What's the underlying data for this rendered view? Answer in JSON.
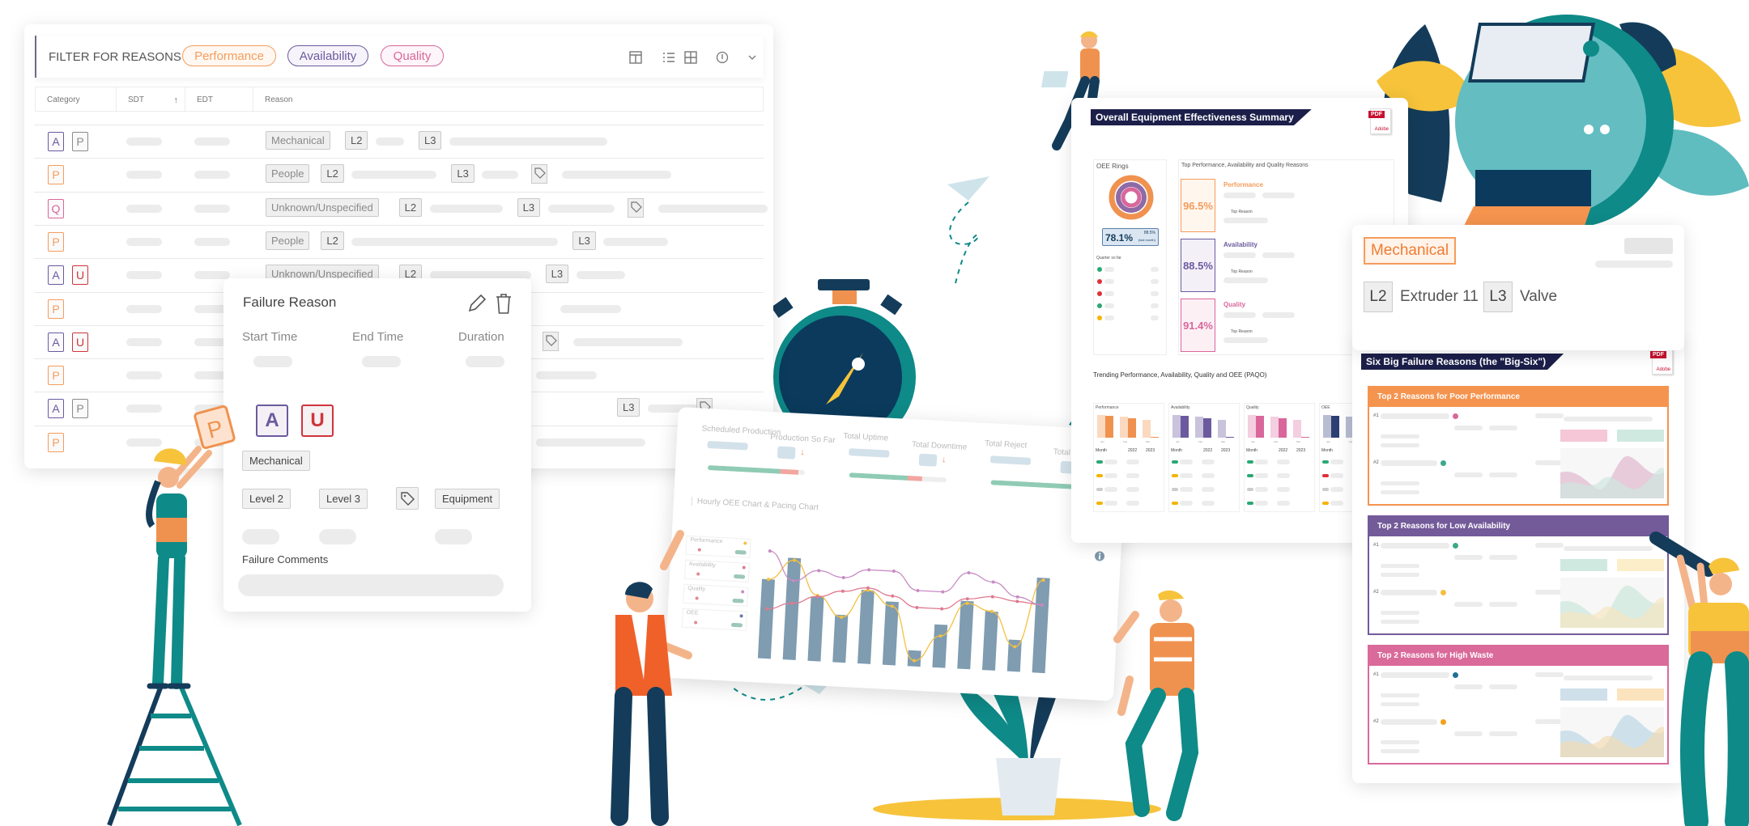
{
  "filter_panel": {
    "title": "FILTER FOR REASONS",
    "filters": [
      {
        "label": "Performance",
        "color": "#f59c5b"
      },
      {
        "label": "Availability",
        "color": "#6b5a9e"
      },
      {
        "label": "Quality",
        "color": "#d9679b"
      }
    ],
    "toolbar_icons": [
      "layout-icon",
      "list-icon",
      "grid-icon",
      "info-icon",
      "chevron-down-icon"
    ],
    "columns": [
      "Category",
      "SDT",
      "EDT",
      "Reason"
    ],
    "sort_icon": "arrow-up-icon",
    "rows": [
      {
        "categories": [
          "A",
          "P"
        ],
        "reason": "Mechanical",
        "l2": "L2",
        "l3": "L3",
        "tag": false
      },
      {
        "categories": [
          "P"
        ],
        "reason": "People",
        "l2": "L2",
        "l3": "L3",
        "tag": true
      },
      {
        "categories": [
          "Q"
        ],
        "reason": "Unknown/Unspecified",
        "l2": "L2",
        "l3": "L3",
        "tag": true
      },
      {
        "categories": [
          "P"
        ],
        "reason": "People",
        "l2": "L2",
        "l3": "L3",
        "tag": false
      },
      {
        "categories": [
          "A",
          "U"
        ],
        "reason": "Unknown/Unspecified",
        "l2": "L2",
        "l3": "L3",
        "tag": false
      },
      {
        "categories": [
          "P"
        ]
      },
      {
        "categories": [
          "A",
          "U"
        ],
        "tag": true
      },
      {
        "categories": [
          "P"
        ]
      },
      {
        "categories": [
          "A",
          "P"
        ],
        "l3": "L3",
        "tag": true
      },
      {
        "categories": [
          "P"
        ]
      }
    ],
    "category_colors": {
      "A": "#6b5a9e",
      "P": "#f59c5b",
      "Q": "#d9679b",
      "U": "#d0343d",
      "P-secondary": "#8a8a8a"
    }
  },
  "failure_reason": {
    "title": "Failure Reason",
    "edit_icon": "pencil-icon",
    "delete_icon": "trash-icon",
    "time_labels": [
      "Start Time",
      "End Time",
      "Duration"
    ],
    "categories": [
      "A",
      "U"
    ],
    "reason": "Mechanical",
    "levels": [
      "Level 2",
      "Level 3"
    ],
    "equipment": "Equipment",
    "comments_label": "Failure Comments",
    "held_card": "P"
  },
  "oee_summary": {
    "title": "Overall Equipment Effectiveness Summary",
    "pdf_label": "PDF",
    "pdf_brand": "Adobe",
    "rings_title": "OEE Rings",
    "oee_value": "78.1%",
    "oee_last": "88.5%",
    "oee_last_label": "(last month)",
    "quarter_label": "Quarter so far",
    "quarter_dots": [
      "#2aa876",
      "#e0303a",
      "#e0303a",
      "#2aa876",
      "#f4b400"
    ],
    "reasons_title": "Top Performance, Availability and Quality Reasons",
    "metrics": [
      {
        "name": "Performance",
        "value": "96.5%",
        "color": "#f59c5b",
        "bg": "#fff6ee",
        "sub": "Top Reason"
      },
      {
        "name": "Availability",
        "value": "88.5%",
        "color": "#6b5a9e",
        "bg": "#f3f0f8",
        "sub": "Top Reason"
      },
      {
        "name": "Quality",
        "value": "91.4%",
        "color": "#d9679b",
        "bg": "#fcf0f5",
        "sub": "Top Reason"
      }
    ],
    "trending_title": "Trending Performance, Availability, Quality and OEE (PAQO)",
    "trend_panels": [
      {
        "name": "Performance",
        "c1": "#fbd9bf",
        "c2": "#f0924f"
      },
      {
        "name": "Availability",
        "c1": "#c9c3dc",
        "c2": "#6b5a9e"
      },
      {
        "name": "Quality",
        "c1": "#f3cfe0",
        "c2": "#d9679b"
      },
      {
        "name": "OEE",
        "c1": "#b9bdd2",
        "c2": "#2b3f73"
      }
    ],
    "trend_months": [
      "Jan",
      "Feb",
      "Mar"
    ],
    "trend_legend": [
      "Month",
      "2022",
      "2023"
    ]
  },
  "mechanical_card": {
    "reason": "Mechanical",
    "l2_label": "L2",
    "l2_value": "Extruder 11",
    "l3_label": "L3",
    "l3_value": "Valve"
  },
  "big_six": {
    "title": "Six Big Failure Reasons (the \"Big-Six\")",
    "pdf_label": "PDF",
    "pdf_brand": "Adobe",
    "sections": [
      {
        "title": "Top 2 Reasons for Poor Performance",
        "color": "#f5944f",
        "dots": [
          "#d9679b",
          "#3aa98a"
        ],
        "chips": [
          "#f6c7d6",
          "#cfe9e1"
        ],
        "areas": [
          "#e4bfd3",
          "#cfe6e0"
        ]
      },
      {
        "title": "Top 2 Reasons for Low Availability",
        "color": "#735a99",
        "dots": [
          "#3aa98a",
          "#f4c042"
        ],
        "chips": [
          "#cfe9e1",
          "#fbeec8"
        ],
        "areas": [
          "#cfe8df",
          "#f7e6c0"
        ]
      },
      {
        "title": "Top 2 Reasons for High Waste",
        "color": "#d96a9a",
        "dots": [
          "#1f6f96",
          "#f3a11c"
        ],
        "chips": [
          "#cfe0ea",
          "#fbe3bd"
        ],
        "areas": [
          "#c3dbe6",
          "#f2dcb4"
        ]
      }
    ],
    "rank_labels": [
      "#1",
      "#2"
    ]
  },
  "tablet": {
    "kpis": [
      {
        "label": "Scheduled Production"
      },
      {
        "label": "Production So Far",
        "trend": "down"
      },
      {
        "label": "Total Uptime"
      },
      {
        "label": "Total Downtime",
        "trend": "down"
      },
      {
        "label": "Total Reject"
      },
      {
        "label": "Total Production",
        "trend": "down"
      }
    ],
    "progress": [
      0.93,
      0.75,
      0.88
    ],
    "chart_title": "Hourly OEE Chart & Pacing Chart",
    "legend": [
      "Performance",
      "Availability",
      "Quality",
      "OEE"
    ],
    "legend_dots": [
      "#f4c042",
      "#e07a8f",
      "#c88bc4",
      "#6b7aa8"
    ],
    "bars": [
      70,
      90,
      57,
      42,
      65,
      56,
      14,
      38,
      60,
      52,
      28,
      84
    ],
    "lines": [
      {
        "color": "#f4c042",
        "values": [
          70,
          88,
          58,
          40,
          65,
          52,
          5,
          28,
          58,
          52,
          22,
          82
        ]
      },
      {
        "color": "#e07a8f",
        "values": [
          44,
          50,
          57,
          63,
          67,
          61,
          52,
          52,
          62,
          65,
          62,
          60
        ]
      },
      {
        "color": "#c88bc4",
        "values": [
          95,
          70,
          80,
          75,
          83,
          83,
          67,
          67,
          85,
          78,
          66,
          60
        ]
      }
    ],
    "info_icon": "info-icon"
  },
  "colors": {
    "teal": "#0e8a88",
    "navy": "#143c5a",
    "yellow": "#f6c33b",
    "orange": "#f0612a",
    "skin": "#f4b48a"
  }
}
